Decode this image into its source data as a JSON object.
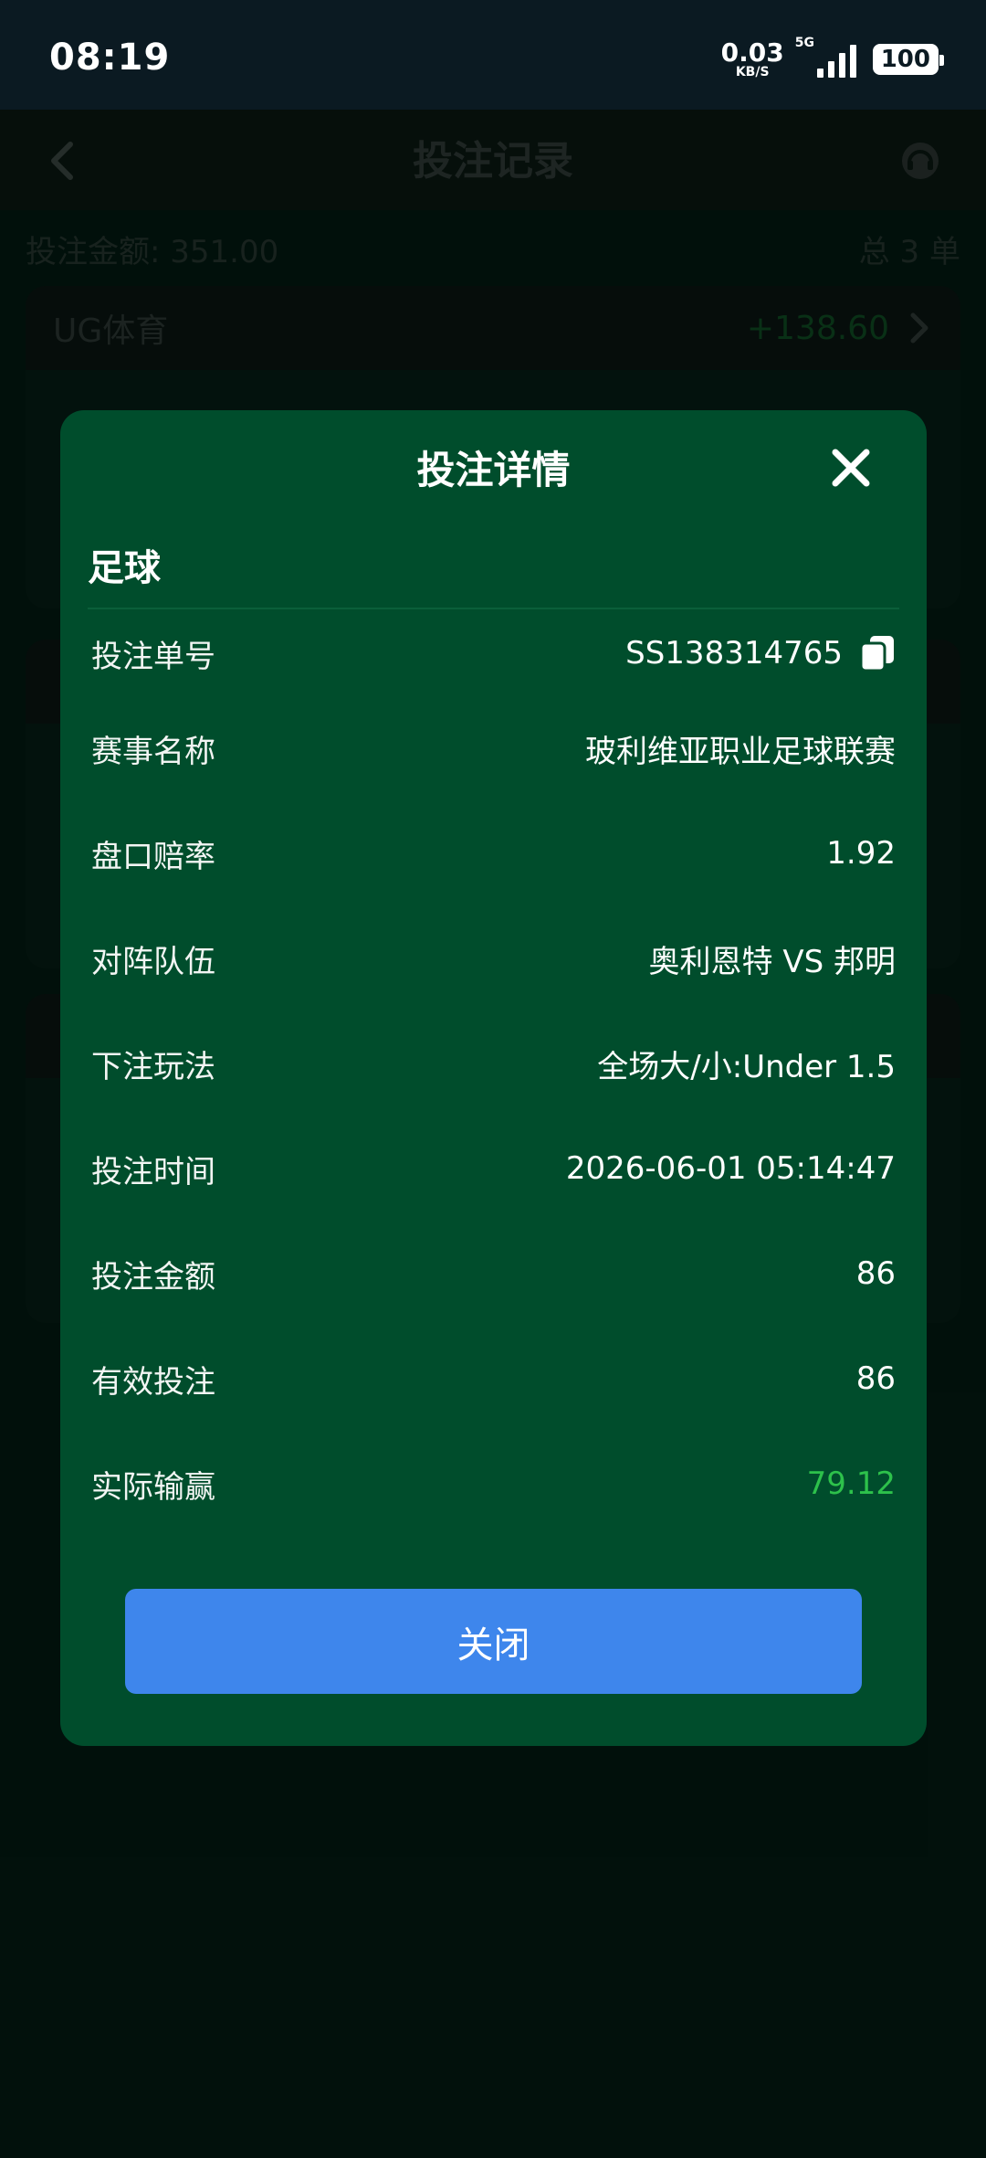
{
  "status_bar": {
    "time": "08:19",
    "net_speed_value": "0.03",
    "net_speed_unit": "KB/S",
    "network_type": "5G",
    "battery": "100"
  },
  "header": {
    "title": "投注记录"
  },
  "summary": {
    "bet_amount": "投注金额: 351.00",
    "total_orders": "总 3 单"
  },
  "cards": [
    {
      "provider": "UG体育",
      "profit": "+138.60"
    }
  ],
  "modal": {
    "title": "投注详情",
    "sport": "足球",
    "rows": [
      {
        "label": "投注单号",
        "value": "SS138314765"
      },
      {
        "label": "赛事名称",
        "value": "玻利维亚职业足球联赛"
      },
      {
        "label": "盘口赔率",
        "value": "1.92"
      },
      {
        "label": "对阵队伍",
        "value": "奥利恩特 VS 邦明"
      },
      {
        "label": "下注玩法",
        "value": "全场大/小:Under 1.5"
      },
      {
        "label": "投注时间",
        "value": "2026-06-01 05:14:47"
      },
      {
        "label": "投注金额",
        "value": "86"
      },
      {
        "label": "有效投注",
        "value": "86"
      },
      {
        "label": "实际输赢",
        "value": "79.12"
      }
    ],
    "close_label": "关闭"
  },
  "colors": {
    "modal_bg": "#004d2c",
    "win_text": "#2dc14b",
    "button": "#3e86ec"
  }
}
